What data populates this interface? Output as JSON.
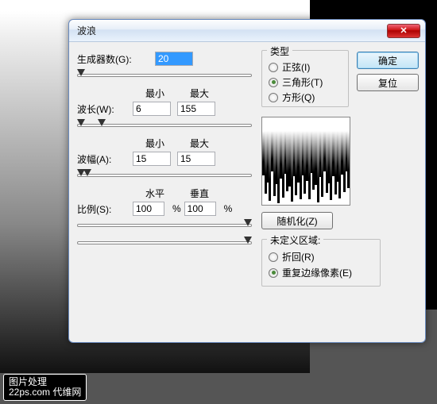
{
  "bg_watermark_line1": "图片处理",
  "bg_watermark_line2": "22ps.com 代维网",
  "dialog": {
    "title": "波浪",
    "generators_label": "生成器数(G):",
    "generators_value": "20",
    "min_label": "最小",
    "max_label": "最大",
    "wavelength_label": "波长(W):",
    "wavelength_min": "6",
    "wavelength_max": "155",
    "amplitude_label": "波幅(A):",
    "amplitude_min": "15",
    "amplitude_max": "15",
    "horiz_label": "水平",
    "vert_label": "垂直",
    "scale_label": "比例(S):",
    "scale_h": "100",
    "scale_v": "100",
    "percent": "%",
    "type_legend": "类型",
    "type_sine": "正弦(I)",
    "type_triangle": "三角形(T)",
    "type_square": "方形(Q)",
    "ok": "确定",
    "reset": "复位",
    "randomize": "随机化(Z)",
    "undef_legend": "未定义区域:",
    "undef_wrap": "折回(R)",
    "undef_repeat": "重复边缘像素(E)"
  }
}
